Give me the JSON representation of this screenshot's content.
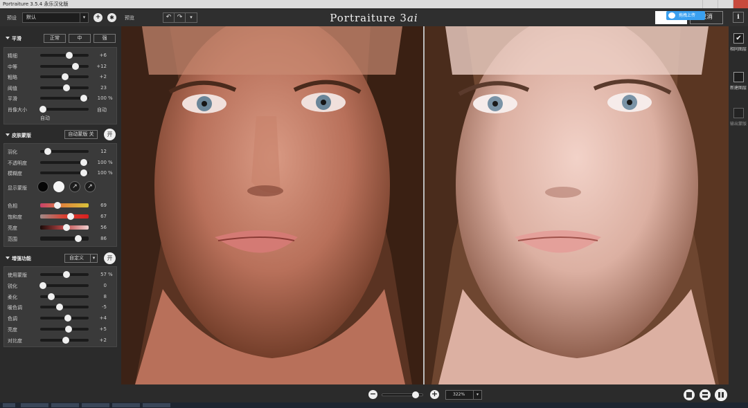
{
  "window": {
    "title": "Portraiture 3.5.4 永乐汉化版"
  },
  "toolbar": {
    "preset_label": "预设",
    "preset_value": "默认",
    "add_icon": "plus-icon",
    "settings_icon": "gear-icon",
    "preview_label": "预览",
    "app_title_main": "Portraiture 3",
    "app_title_suffix": "ai",
    "cancel_label": "取消",
    "upload_badge": "拖拽上传",
    "info_label": "i"
  },
  "smoothing": {
    "title": "平滑",
    "modes": [
      "正常",
      "中",
      "强"
    ],
    "sliders": [
      {
        "label": "精细",
        "value": "+6",
        "unit": "",
        "pos": 0.62
      },
      {
        "label": "中等",
        "value": "+12",
        "unit": "",
        "pos": 0.75
      },
      {
        "label": "粗略",
        "value": "+2",
        "unit": "",
        "pos": 0.52
      },
      {
        "label": "阈值",
        "value": "23",
        "unit": "",
        "pos": 0.55
      },
      {
        "label": "平滑",
        "value": "100",
        "unit": "%",
        "pos": 0.95
      },
      {
        "label": "肖像大小",
        "value": "自动",
        "unit": "",
        "pos": 0.0
      }
    ],
    "portrait_size_sub": "自动"
  },
  "skin_mask": {
    "title": "皮肤蒙版",
    "auto_mask_label": "自动蒙版 关",
    "toggle_label": "开",
    "sliders": [
      {
        "label": "羽化",
        "value": "12",
        "unit": "",
        "pos": 0.12
      },
      {
        "label": "不透明度",
        "value": "100",
        "unit": "%",
        "pos": 0.95
      },
      {
        "label": "模糊度",
        "value": "100",
        "unit": "%",
        "pos": 0.95
      }
    ],
    "show_mask_label": "显示蒙版",
    "picker_icons": [
      "eyedropper-icon",
      "eyedropper-plus-icon"
    ],
    "color_sliders": [
      {
        "label": "色相",
        "value": "69",
        "pos": 0.34,
        "gradient": [
          "#c8406a",
          "#e08a3a",
          "#d8c23a"
        ]
      },
      {
        "label": "饱和度",
        "value": "67",
        "pos": 0.64,
        "gradient": [
          "#a08a88",
          "#d84030",
          "#d82020"
        ]
      },
      {
        "label": "亮度",
        "value": "56",
        "pos": 0.55,
        "gradient": [
          "#1a0a08",
          "#c04848",
          "#f0d0d0"
        ]
      },
      {
        "label": "范围",
        "value": "86",
        "pos": 0.82,
        "gradient": [
          "#1a1a1a",
          "#1a1a1a",
          "#1a1a1a"
        ]
      }
    ]
  },
  "enhance": {
    "title": "增强功能",
    "mode_label": "自定义",
    "toggle_label": "开",
    "sliders": [
      {
        "label": "使用蒙版",
        "value": "57",
        "unit": "%",
        "pos": 0.55
      },
      {
        "label": "锐化",
        "value": "0",
        "unit": "",
        "pos": 0.0
      },
      {
        "label": "柔化",
        "value": "8",
        "unit": "",
        "pos": 0.2
      },
      {
        "label": "暖色调",
        "value": "-5",
        "unit": "",
        "pos": 0.38
      },
      {
        "label": "色调",
        "value": "+4",
        "unit": "",
        "pos": 0.58
      },
      {
        "label": "亮度",
        "value": "+5",
        "unit": "",
        "pos": 0.6
      },
      {
        "label": "对比度",
        "value": "+2",
        "unit": "",
        "pos": 0.54
      }
    ]
  },
  "right_panel": {
    "items": [
      {
        "label": "相同图层",
        "checked": true
      },
      {
        "label": "新建图层",
        "checked": false
      },
      {
        "label": "输出蒙版",
        "checked": false
      }
    ]
  },
  "bottom": {
    "zoom_value": "322%",
    "zoom_pos": 0.85,
    "view_modes": [
      "single-view-icon",
      "split-horizontal-icon",
      "split-vertical-icon"
    ]
  },
  "colors": {
    "accent_badge": "#3aa0f0",
    "panel_bg": "#3a3a3a",
    "app_bg": "#2b2b2b"
  }
}
